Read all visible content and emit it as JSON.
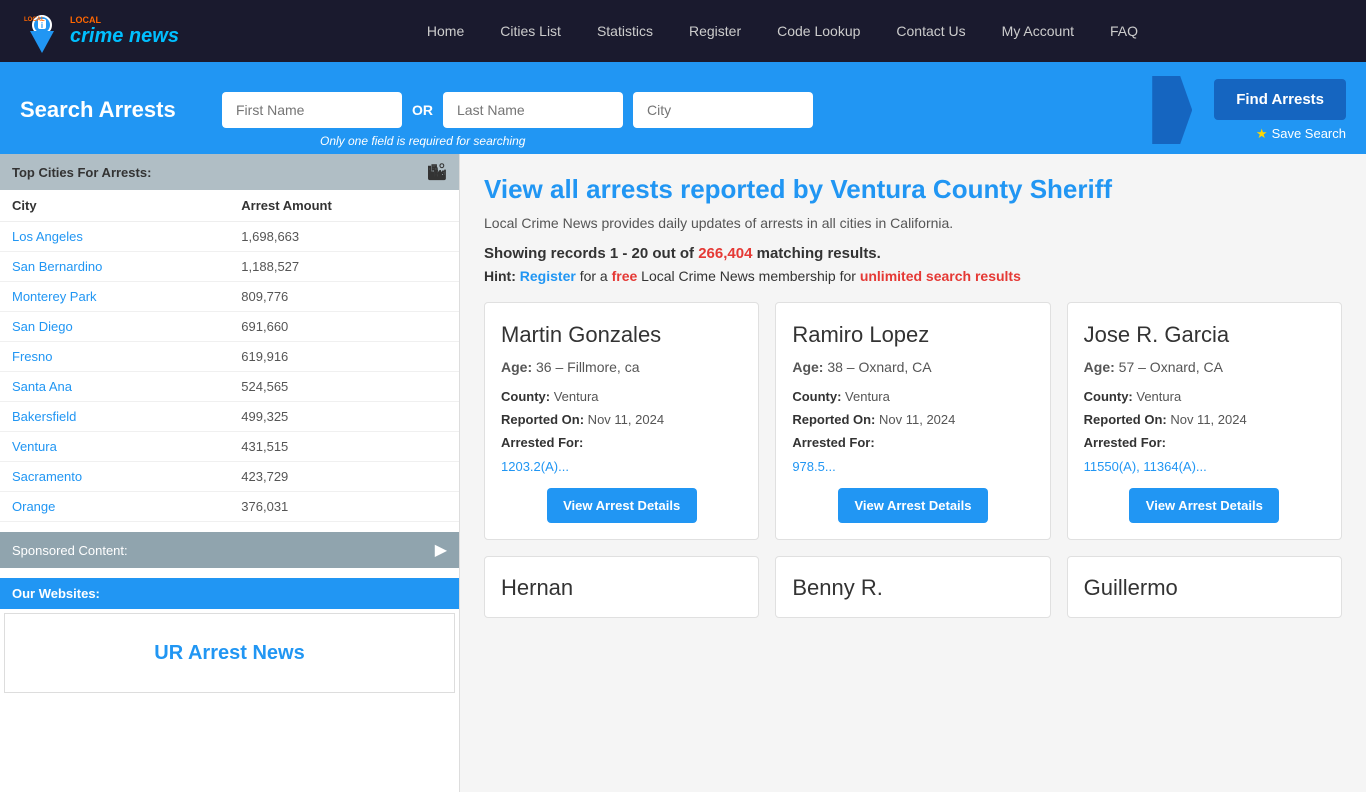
{
  "navbar": {
    "logo_text": "crime news",
    "logo_local": "LOCAL",
    "links": [
      {
        "label": "Home",
        "id": "home"
      },
      {
        "label": "Cities List",
        "id": "cities-list"
      },
      {
        "label": "Statistics",
        "id": "statistics"
      },
      {
        "label": "Register",
        "id": "register"
      },
      {
        "label": "Code Lookup",
        "id": "code-lookup"
      },
      {
        "label": "Contact Us",
        "id": "contact-us"
      },
      {
        "label": "My Account",
        "id": "my-account"
      },
      {
        "label": "FAQ",
        "id": "faq"
      }
    ]
  },
  "search_bar": {
    "title": "Search Arrests",
    "first_name_placeholder": "First Name",
    "last_name_placeholder": "Last Name",
    "city_placeholder": "City",
    "or_label": "OR",
    "hint": "Only one field is required for searching",
    "find_arrests_label": "Find Arrests",
    "save_search_label": "Save Search"
  },
  "sidebar": {
    "top_cities_title": "Top Cities For Arrests:",
    "col_city": "City",
    "col_arrest_amount": "Arrest Amount",
    "cities": [
      {
        "name": "Los Angeles",
        "count": "1,698,663"
      },
      {
        "name": "San Bernardino",
        "count": "1,188,527"
      },
      {
        "name": "Monterey Park",
        "count": "809,776"
      },
      {
        "name": "San Diego",
        "count": "691,660"
      },
      {
        "name": "Fresno",
        "count": "619,916"
      },
      {
        "name": "Santa Ana",
        "count": "524,565"
      },
      {
        "name": "Bakersfield",
        "count": "499,325"
      },
      {
        "name": "Ventura",
        "count": "431,515"
      },
      {
        "name": "Sacramento",
        "count": "423,729"
      },
      {
        "name": "Orange",
        "count": "376,031"
      }
    ],
    "sponsored_label": "Sponsored Content:",
    "our_websites_label": "Our Websites:",
    "ur_arrest_news": "UR Arrest News"
  },
  "content": {
    "heading": "View all arrests reported by Ventura County Sheriff",
    "subtext": "Local Crime News provides daily updates of arrests in all cities in California.",
    "results_range": "1 - 20",
    "results_total": "266,404",
    "results_label": "matching results.",
    "hint_prefix": "Hint:",
    "hint_register": "Register",
    "hint_free": "free",
    "hint_middle": "Local Crime News membership for",
    "hint_unlimited": "unlimited search results",
    "showing_prefix": "Showing records",
    "showing_out_of": "out of"
  },
  "cards": [
    {
      "name": "Martin Gonzales",
      "age": "36",
      "location": "Fillmore, ca",
      "county": "Ventura",
      "reported_on": "Nov 11, 2024",
      "arrested_for_label": "Arrested For:",
      "code": "1203.2(A)...",
      "btn_label": "View Arrest Details"
    },
    {
      "name": "Ramiro Lopez",
      "age": "38",
      "location": "Oxnard, CA",
      "county": "Ventura",
      "reported_on": "Nov 11, 2024",
      "arrested_for_label": "Arrested For:",
      "code": "978.5...",
      "btn_label": "View Arrest Details"
    },
    {
      "name": "Jose R. Garcia",
      "age": "57",
      "location": "Oxnard, CA",
      "county": "Ventura",
      "reported_on": "Nov 11, 2024",
      "arrested_for_label": "Arrested For:",
      "code": "11550(A), 11364(A)...",
      "btn_label": "View Arrest Details"
    }
  ],
  "partial_cards": [
    {
      "name": "Hernan"
    },
    {
      "name": "Benny R."
    },
    {
      "name": "Guillermo"
    }
  ]
}
